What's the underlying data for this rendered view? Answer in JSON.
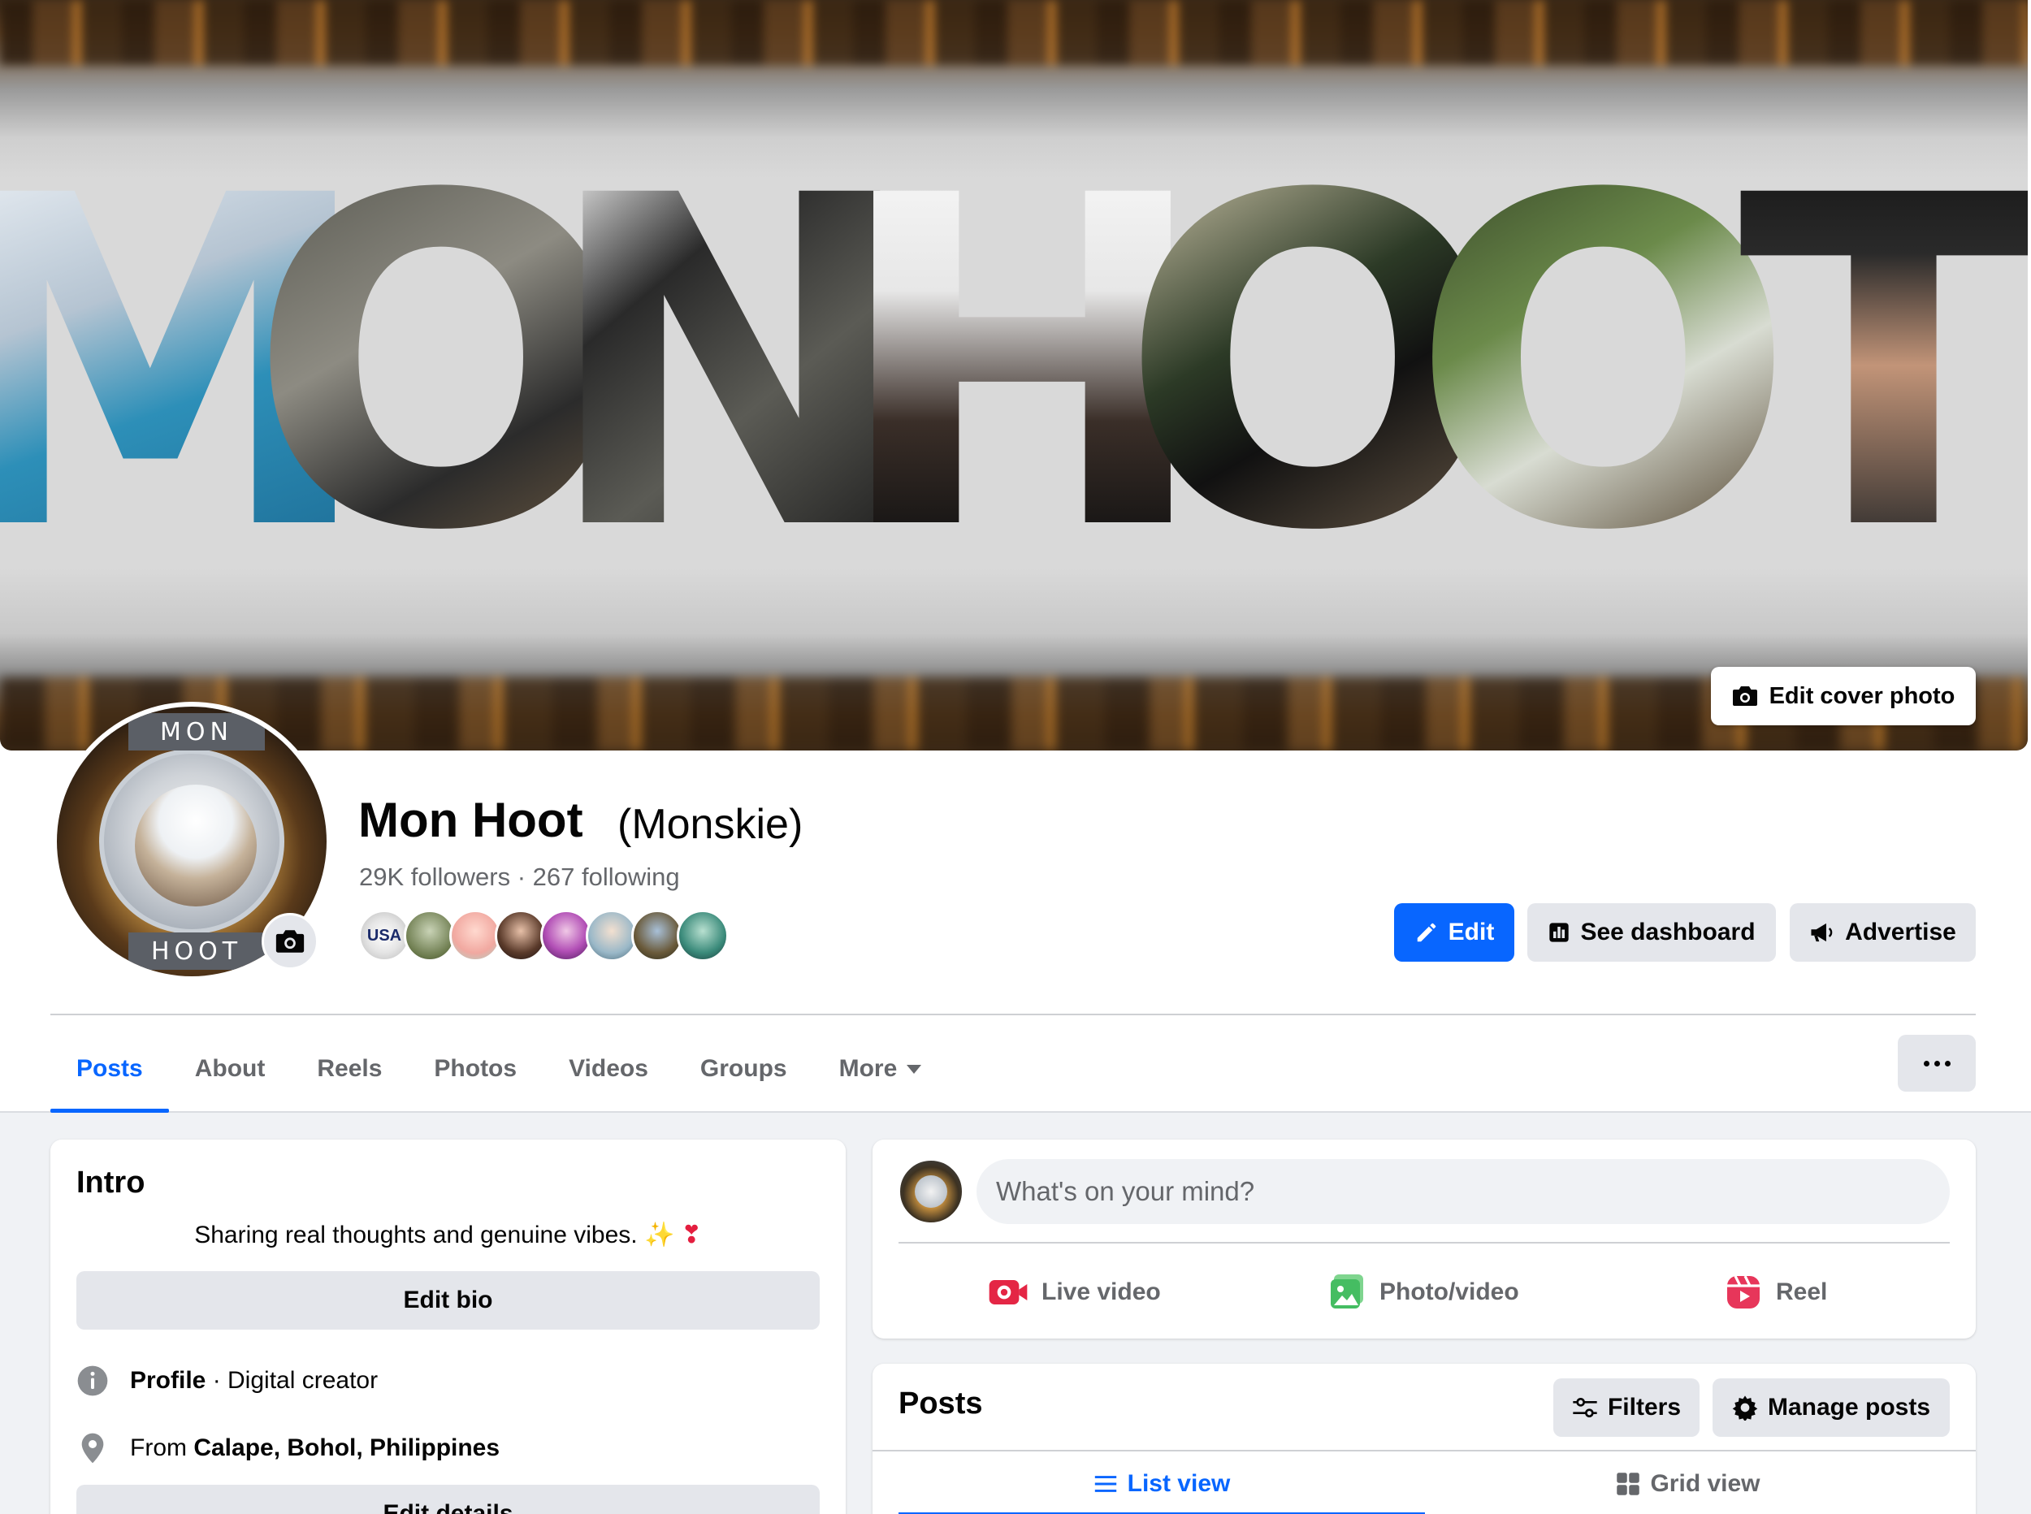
{
  "cover": {
    "letters": [
      "M",
      "O",
      "N",
      "H",
      "O",
      "O",
      "T"
    ],
    "edit_cover_label": "Edit cover photo"
  },
  "avatar": {
    "band_top": "MON",
    "band_bottom": "HOOT"
  },
  "profile": {
    "name": "Mon Hoot",
    "alternate_name": "(Monskie)",
    "stats": "29K followers · 267 following",
    "friend_avatars": [
      "USA",
      "",
      "",
      "",
      "",
      "",
      "",
      ""
    ]
  },
  "actions": {
    "edit_label": "Edit",
    "dashboard_label": "See dashboard",
    "advertise_label": "Advertise",
    "accent_color": "#0866ff"
  },
  "tabs": [
    {
      "label": "Posts",
      "active": true
    },
    {
      "label": "About",
      "active": false
    },
    {
      "label": "Reels",
      "active": false
    },
    {
      "label": "Photos",
      "active": false
    },
    {
      "label": "Videos",
      "active": false
    },
    {
      "label": "Groups",
      "active": false
    },
    {
      "label": "More",
      "active": false
    }
  ],
  "intro": {
    "title": "Intro",
    "bio": "Sharing real thoughts and genuine vibes.",
    "bio_emoji_1": "✨",
    "bio_emoji_2": "❣",
    "edit_bio_label": "Edit bio",
    "profile_label": "Profile",
    "profile_category": " · Digital creator",
    "from_prefix": "From ",
    "from_place": "Calape, Bohol, Philippines",
    "edit_details_label": "Edit details"
  },
  "composer": {
    "placeholder": "What's on your mind?",
    "live_video_label": "Live video",
    "photo_video_label": "Photo/video",
    "reel_label": "Reel",
    "live_color": "#e42645",
    "photo_color": "#45bd62",
    "reel_color": "#e7365a"
  },
  "posts": {
    "title": "Posts",
    "filters_label": "Filters",
    "manage_label": "Manage posts",
    "list_view_label": "List view",
    "grid_view_label": "Grid view"
  }
}
